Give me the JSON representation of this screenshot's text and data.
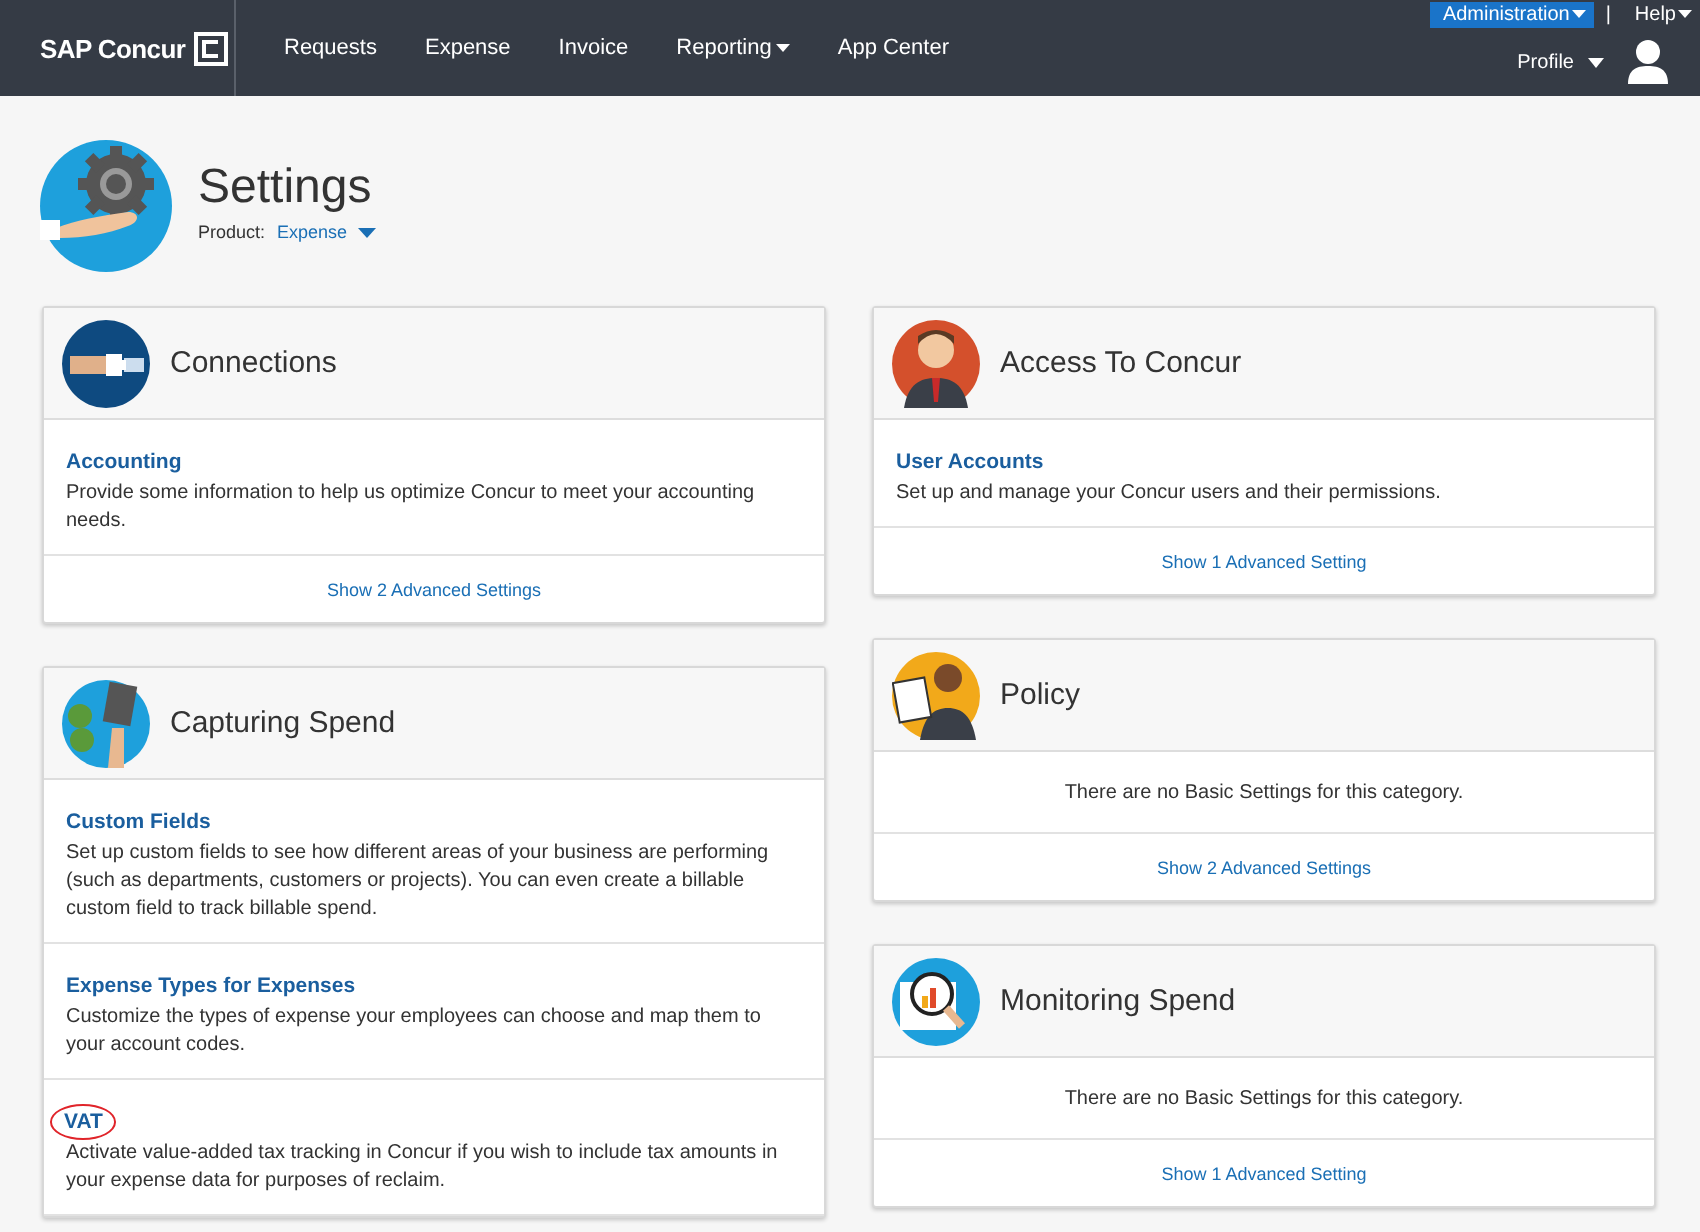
{
  "header": {
    "logo": "SAP Concur",
    "nav": [
      {
        "label": "Requests",
        "dropdown": false
      },
      {
        "label": "Expense",
        "dropdown": false
      },
      {
        "label": "Invoice",
        "dropdown": false
      },
      {
        "label": "Reporting",
        "dropdown": true
      },
      {
        "label": "App Center",
        "dropdown": false
      }
    ],
    "top_links": [
      {
        "label": "Administration",
        "highlighted": true
      },
      {
        "label": "Help",
        "highlighted": false
      }
    ],
    "separator": "|",
    "profile": "Profile"
  },
  "page": {
    "title": "Settings",
    "product_label": "Product:",
    "product": "Expense"
  },
  "columns": [
    [
      {
        "title": "Connections",
        "kind": "connections",
        "items": [
          {
            "title": "Accounting",
            "description": "Provide some information to help us optimize Concur to meet your accounting needs.",
            "circled": false
          }
        ],
        "footer": "Show 2 Advanced Settings"
      },
      {
        "title": "Capturing Spend",
        "kind": "capturing",
        "items": [
          {
            "title": "Custom Fields",
            "description": "Set up custom fields to see how different areas of your business are performing (such as departments, customers or projects). You can even create a billable custom field to track billable spend.",
            "circled": false
          },
          {
            "title": "Expense Types for Expenses",
            "description": "Customize the types of expense your employees can choose and map them to your account codes.",
            "circled": false
          },
          {
            "title": "VAT",
            "description": "Activate value-added tax tracking in Concur if you wish to include tax amounts in your expense data for purposes of reclaim.",
            "circled": true
          }
        ]
      }
    ],
    [
      {
        "title": "Access To Concur",
        "kind": "access",
        "items": [
          {
            "title": "User Accounts",
            "description": "Set up and manage your Concur users and their permissions.",
            "circled": false
          }
        ],
        "footer": "Show 1 Advanced Setting"
      },
      {
        "title": "Policy",
        "kind": "policy",
        "empty": "There are no Basic Settings for this category.",
        "footer": "Show 2 Advanced Settings"
      },
      {
        "title": "Monitoring Spend",
        "kind": "monitoring",
        "empty": "There are no Basic Settings for this category.",
        "footer": "Show 1 Advanced Setting"
      }
    ]
  ]
}
